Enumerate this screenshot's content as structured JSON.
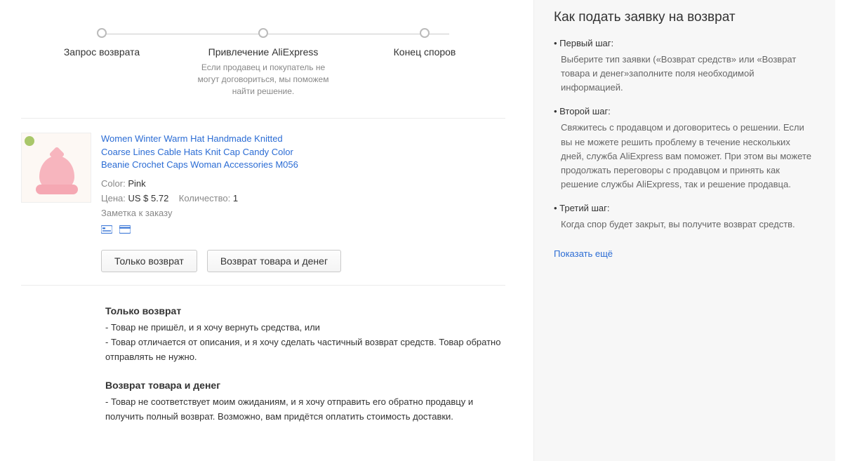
{
  "tracker": {
    "steps": [
      {
        "label": "Запрос возврата",
        "desc": ""
      },
      {
        "label": "Привлечение AliExpress",
        "desc": "Если продавец и покупатель не могут договориться, мы поможем найти решение."
      },
      {
        "label": "Конец споров",
        "desc": ""
      }
    ]
  },
  "product": {
    "title": "Women Winter Warm Hat Handmade Knitted Coarse Lines Cable Hats Knit Cap Candy Color Beanie Crochet Caps Woman Accessories M056",
    "color_label": "Color:",
    "color_value": "Pink",
    "price_label": "Цена:",
    "price_value": "US $ 5.72",
    "qty_label": "Количество:",
    "qty_value": "1",
    "note": "Заметка к заказу",
    "btn_refund": "Только возврат",
    "btn_return": "Возврат товара и денег"
  },
  "explain": {
    "a_title": "Только возврат",
    "a_line1": "- Товар не пришёл, и я хочу вернуть средства, или",
    "a_line2": "- Товар отличается от описания, и я хочу сделать частичный возврат средств. Товар обратно отправлять не нужно.",
    "b_title": "Возврат товара и денег",
    "b_line1": "- Товар не соответствует моим ожиданиям, и я хочу отправить его обратно продавцу и получить полный возврат. Возможно, вам придётся оплатить стоимость доставки."
  },
  "sidebar": {
    "title": "Как подать заявку на возврат",
    "steps": [
      {
        "label": "Первый шаг:",
        "text": "Выберите тип заявки («Возврат средств» или «Возврат товара и денег»заполните поля необходимой информацией."
      },
      {
        "label": "Второй шаг:",
        "text": "Свяжитесь с продавцом и договоритесь о решении. Если вы не можете решить проблему в течение нескольких дней, служба AliExpress вам поможет. При этом вы можете продолжать переговоры с продавцом и принять как решение службы AliExpress, так и решение продавца."
      },
      {
        "label": "Третий шаг:",
        "text": "Когда спор будет закрыт, вы получите возврат средств."
      }
    ],
    "show_more": "Показать ещё"
  }
}
